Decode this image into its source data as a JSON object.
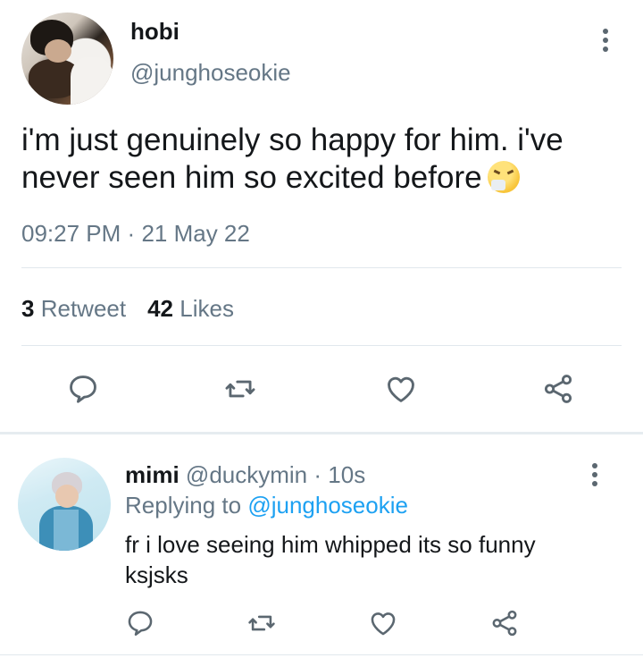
{
  "tweet": {
    "name": "hobi",
    "handle": "@junghoseokie",
    "text": "i'm just genuinely so happy for him. i've never seen him so excited before",
    "emoji_icon": "face-with-tissue-emoji",
    "time": "09:27 PM",
    "dot": "·",
    "date": "21 May 22",
    "retweets_count": "3",
    "retweets_label": "Retweet",
    "likes_count": "42",
    "likes_label": "Likes"
  },
  "reply": {
    "name": "mimi",
    "handle": "@duckymin",
    "dot": "·",
    "time_ago": "10s",
    "replying_to_label": "Replying to",
    "replying_to_handle": "@junghoseokie",
    "text": "fr i love seeing him whipped its so funny ksjsks"
  },
  "icons": {
    "reply": "reply-icon",
    "retweet": "retweet-icon",
    "like": "heart-icon",
    "share": "share-icon",
    "more": "more-vertical-icon"
  },
  "colors": {
    "text": "#14171a",
    "secondary": "#657786",
    "link": "#1da1f2",
    "icon": "#5b6770",
    "divider": "#e1e8ed"
  }
}
